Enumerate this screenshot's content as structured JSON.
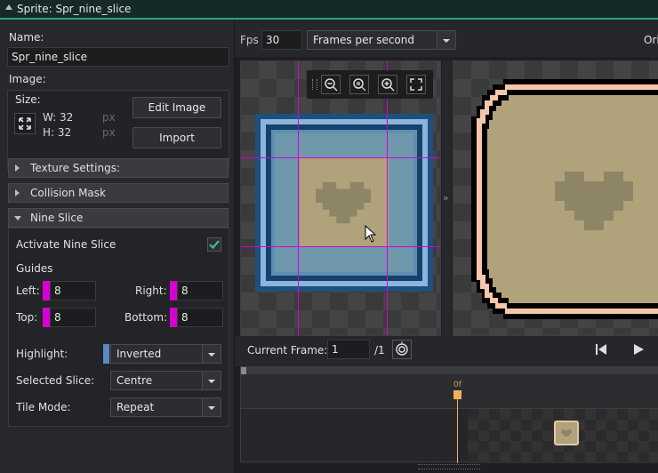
{
  "window": {
    "title": "Sprite: Spr_nine_slice"
  },
  "left": {
    "name_label": "Name:",
    "name_value": "Spr_nine_slice",
    "image_label": "Image:",
    "size_label": "Size:",
    "width_label": "W: 32",
    "height_label": "H: 32",
    "unit_w": "px",
    "unit_h": "px",
    "edit_image": "Edit Image",
    "import": "Import",
    "sections": {
      "texture": "Texture Settings:",
      "collision": "Collision Mask",
      "nine_slice": "Nine Slice"
    },
    "activate_label": "Activate Nine Slice",
    "activate_checked": true,
    "guides_label": "Guides",
    "left_label": "Left:",
    "left_value": "8",
    "right_label": "Right:",
    "right_value": "8",
    "top_label": "Top:",
    "top_value": "8",
    "bottom_label": "Bottom:",
    "bottom_value": "8",
    "highlight_label": "Highlight:",
    "highlight_value": "Inverted",
    "selected_slice_label": "Selected Slice:",
    "selected_slice_value": "Centre",
    "tile_mode_label": "Tile Mode:",
    "tile_mode_value": "Repeat"
  },
  "toolbar": {
    "fps_label": "Fps",
    "fps_value": "30",
    "fps_mode": "Frames per second",
    "origin_label": "Ori"
  },
  "frames": {
    "current_frame_label": "Current Frame:",
    "current_frame_value": "1",
    "total": "/1",
    "marker": "0f"
  },
  "colors": {
    "accent": "#2f9e86",
    "guide": "#d400d4",
    "marker": "#f0b060"
  },
  "icons": [
    "zoom-out-icon",
    "zoom-reset-icon",
    "zoom-in-icon",
    "fit-icon",
    "first-frame-icon",
    "play-icon",
    "onion-skin-icon",
    "expand-icon"
  ]
}
